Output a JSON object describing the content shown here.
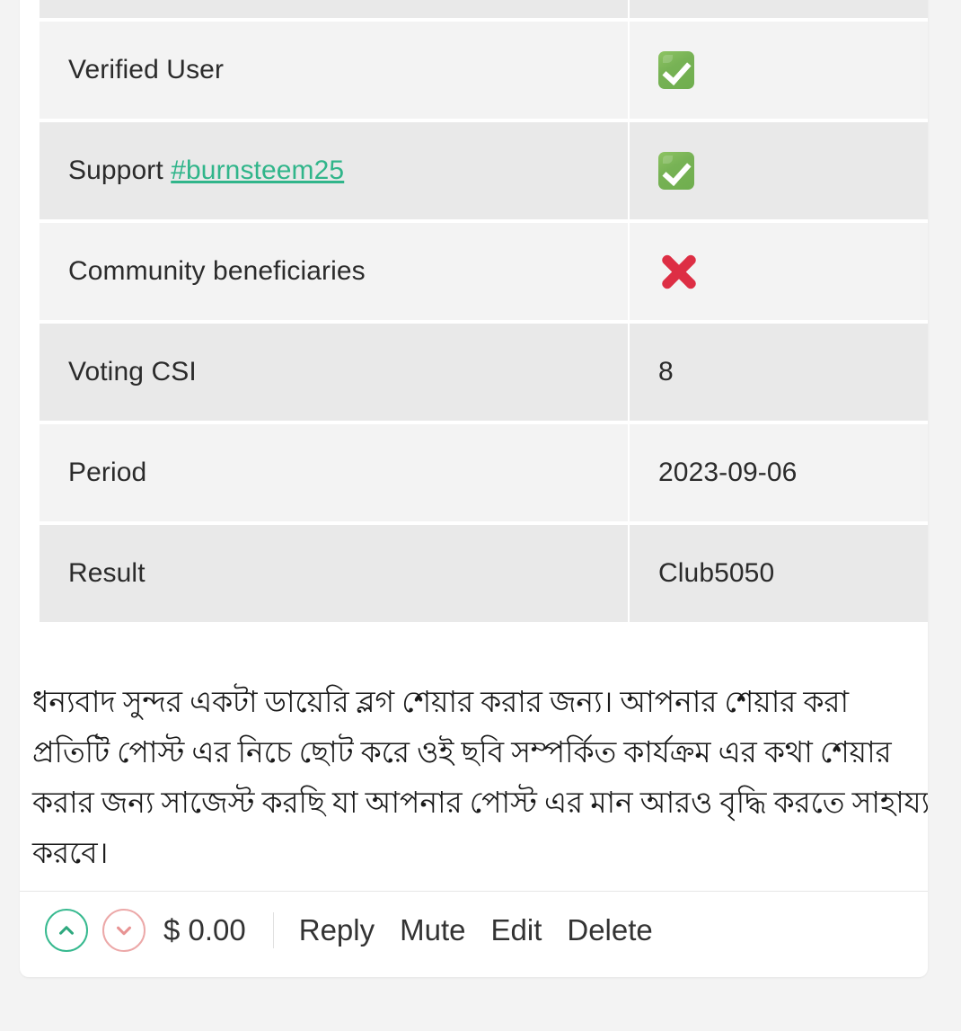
{
  "post_report": {
    "rows": [
      {
        "key": "",
        "value": "",
        "value_type": "empty",
        "shade": "dark",
        "clipped": true
      },
      {
        "key": "Verified User",
        "value": "check-icon",
        "value_type": "check",
        "shade": "light",
        "clipped": false
      },
      {
        "key": "Support ",
        "key_link": "#burnsteem25",
        "value": "check-icon",
        "value_type": "check",
        "shade": "dark",
        "clipped": false
      },
      {
        "key": "Community beneficiaries",
        "value": "cross-icon",
        "value_type": "cross",
        "shade": "light",
        "clipped": false
      },
      {
        "key": "Voting CSI",
        "value": "8",
        "value_type": "text",
        "shade": "dark",
        "clipped": false
      },
      {
        "key": "Period",
        "value": "2023-09-06",
        "value_type": "text",
        "shade": "light",
        "clipped": false
      },
      {
        "key": "Result",
        "value": "Club5050",
        "value_type": "text_bold",
        "shade": "dark",
        "clipped": false
      }
    ]
  },
  "comment": {
    "body": "ধন্যবাদ সুন্দর একটা ডায়েরি ব্লগ শেয়ার করার জন্য। আপনার শেয়ার করা প্রতিটি পোস্ট এর নিচে ছোট করে ওই ছবি সম্পর্কিত কার্যক্রম এর কথা শেয়ার করার জন্য সাজেস্ট করছি যা আপনার পোস্ট এর মান আরও বৃদ্ধি করতে সাহায্য করবে।"
  },
  "footer": {
    "upvote_icon": "chevron-up-icon",
    "downvote_icon": "chevron-down-icon",
    "payout": "$ 0.00",
    "links": [
      {
        "label": "Reply"
      },
      {
        "label": "Mute"
      },
      {
        "label": "Edit"
      },
      {
        "label": "Delete"
      }
    ]
  },
  "colors": {
    "tag_link": "#30b58a",
    "upvote_border": "#37b98f",
    "downvote_border": "#eca8a8",
    "check_green": "#77b255",
    "cross_red": "#dd2e44",
    "row_light": "#f3f3f3",
    "row_dark": "#e9e9e9",
    "page_bg": "#f3f3f3",
    "card_bg": "#ffffff",
    "text": "#2b2b2b"
  }
}
